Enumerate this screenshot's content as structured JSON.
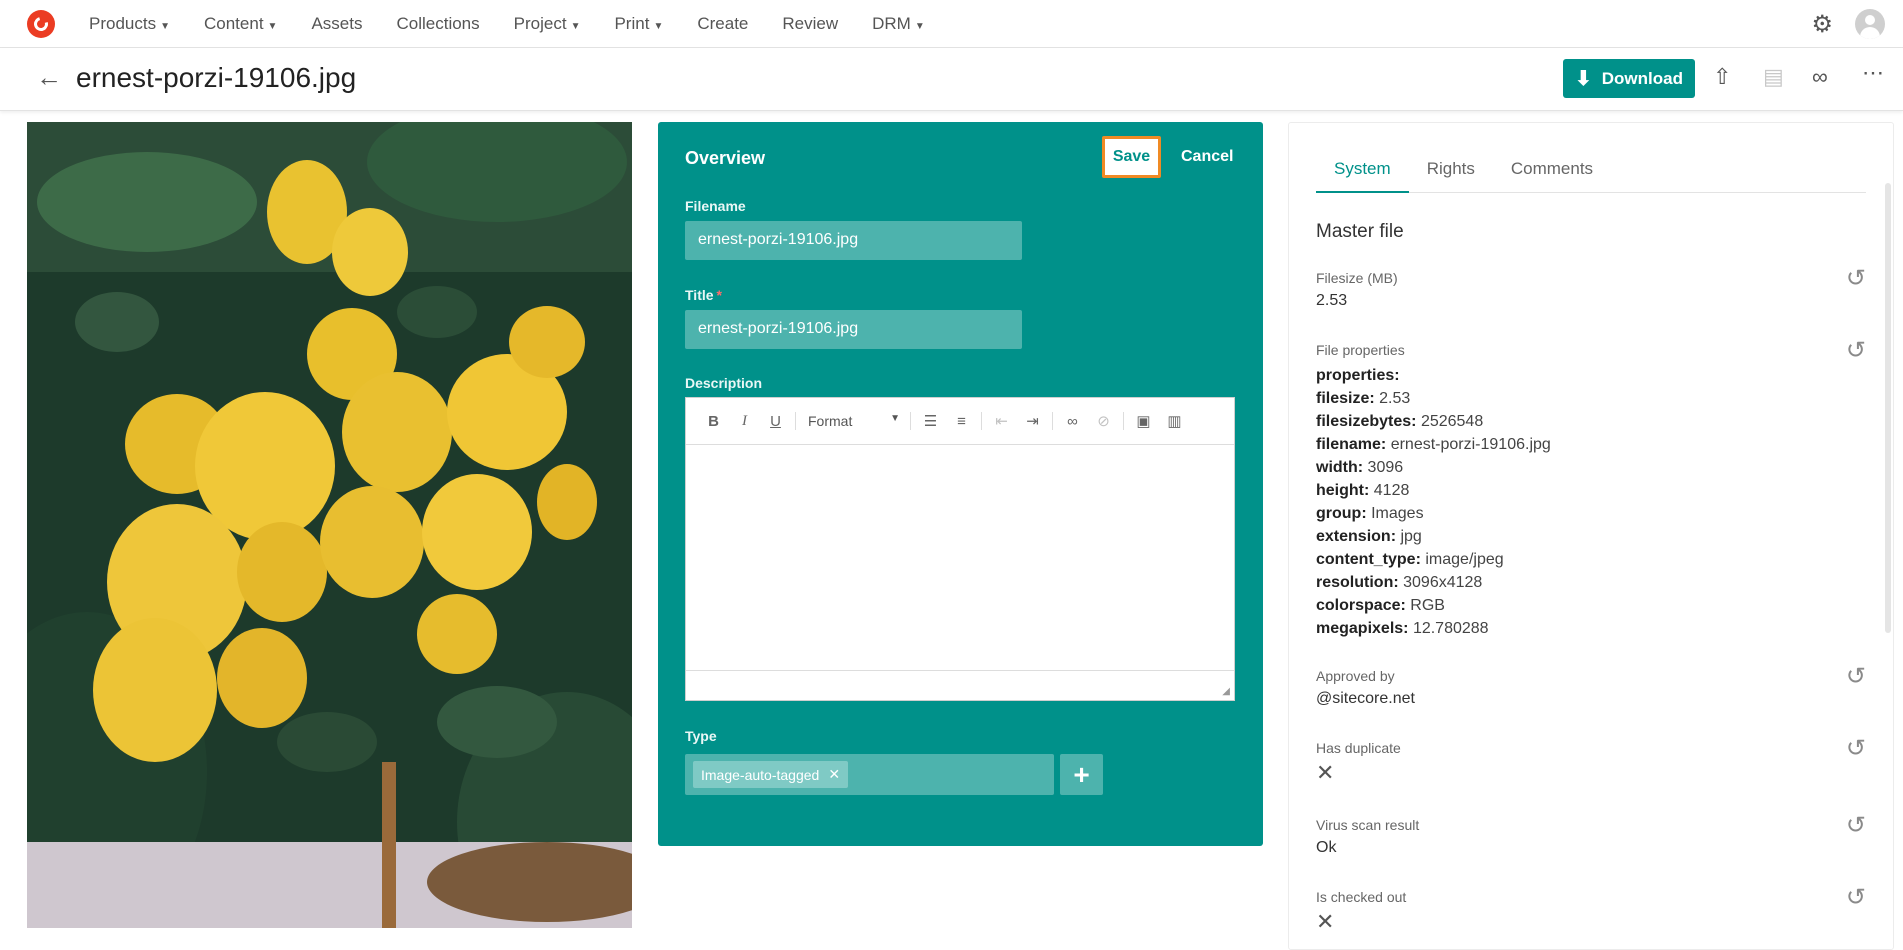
{
  "nav": {
    "items": [
      {
        "label": "Products",
        "caret": true
      },
      {
        "label": "Content",
        "caret": true
      },
      {
        "label": "Assets",
        "caret": false
      },
      {
        "label": "Collections",
        "caret": false
      },
      {
        "label": "Project",
        "caret": true
      },
      {
        "label": "Print",
        "caret": true
      },
      {
        "label": "Create",
        "caret": false
      },
      {
        "label": "Review",
        "caret": false
      },
      {
        "label": "DRM",
        "caret": true
      }
    ],
    "icons": [
      "logo-icon",
      "gear-icon",
      "user-avatar-icon"
    ]
  },
  "header": {
    "title": "ernest-porzi-19106.jpg",
    "download_label": "Download",
    "accent": "#00918a"
  },
  "overview": {
    "title": "Overview",
    "save_label": "Save",
    "cancel_label": "Cancel",
    "filename_label": "Filename",
    "filename_value": "ernest-porzi-19106.jpg",
    "title_label": "Title",
    "title_required": "*",
    "title_value": "ernest-porzi-19106.jpg",
    "description_label": "Description",
    "format_label": "Format",
    "type_label": "Type",
    "type_tags": [
      "Image-auto-tagged"
    ]
  },
  "rpanel": {
    "tabs": [
      "System",
      "Rights",
      "Comments"
    ],
    "active_tab": "System",
    "section_title": "Master file",
    "filesize_label": "Filesize (MB)",
    "filesize_value": "2.53",
    "file_properties_label": "File properties",
    "file_properties": [
      {
        "key": "properties:",
        "value": ""
      },
      {
        "key": "filesize:",
        "value": "2.53"
      },
      {
        "key": "filesizebytes:",
        "value": "2526548"
      },
      {
        "key": "filename:",
        "value": "ernest-porzi-19106.jpg"
      },
      {
        "key": "width:",
        "value": "3096"
      },
      {
        "key": "height:",
        "value": "4128"
      },
      {
        "key": "group:",
        "value": "Images"
      },
      {
        "key": "extension:",
        "value": "jpg"
      },
      {
        "key": "content_type:",
        "value": "image/jpeg"
      },
      {
        "key": "resolution:",
        "value": "3096x4128"
      },
      {
        "key": "colorspace:",
        "value": "RGB"
      },
      {
        "key": "megapixels:",
        "value": "12.780288"
      }
    ],
    "approved_by_label": "Approved by",
    "approved_by_value": "@sitecore.net",
    "has_duplicate_label": "Has duplicate",
    "virus_scan_label": "Virus scan result",
    "virus_scan_value": "Ok",
    "checked_out_label": "Is checked out"
  }
}
